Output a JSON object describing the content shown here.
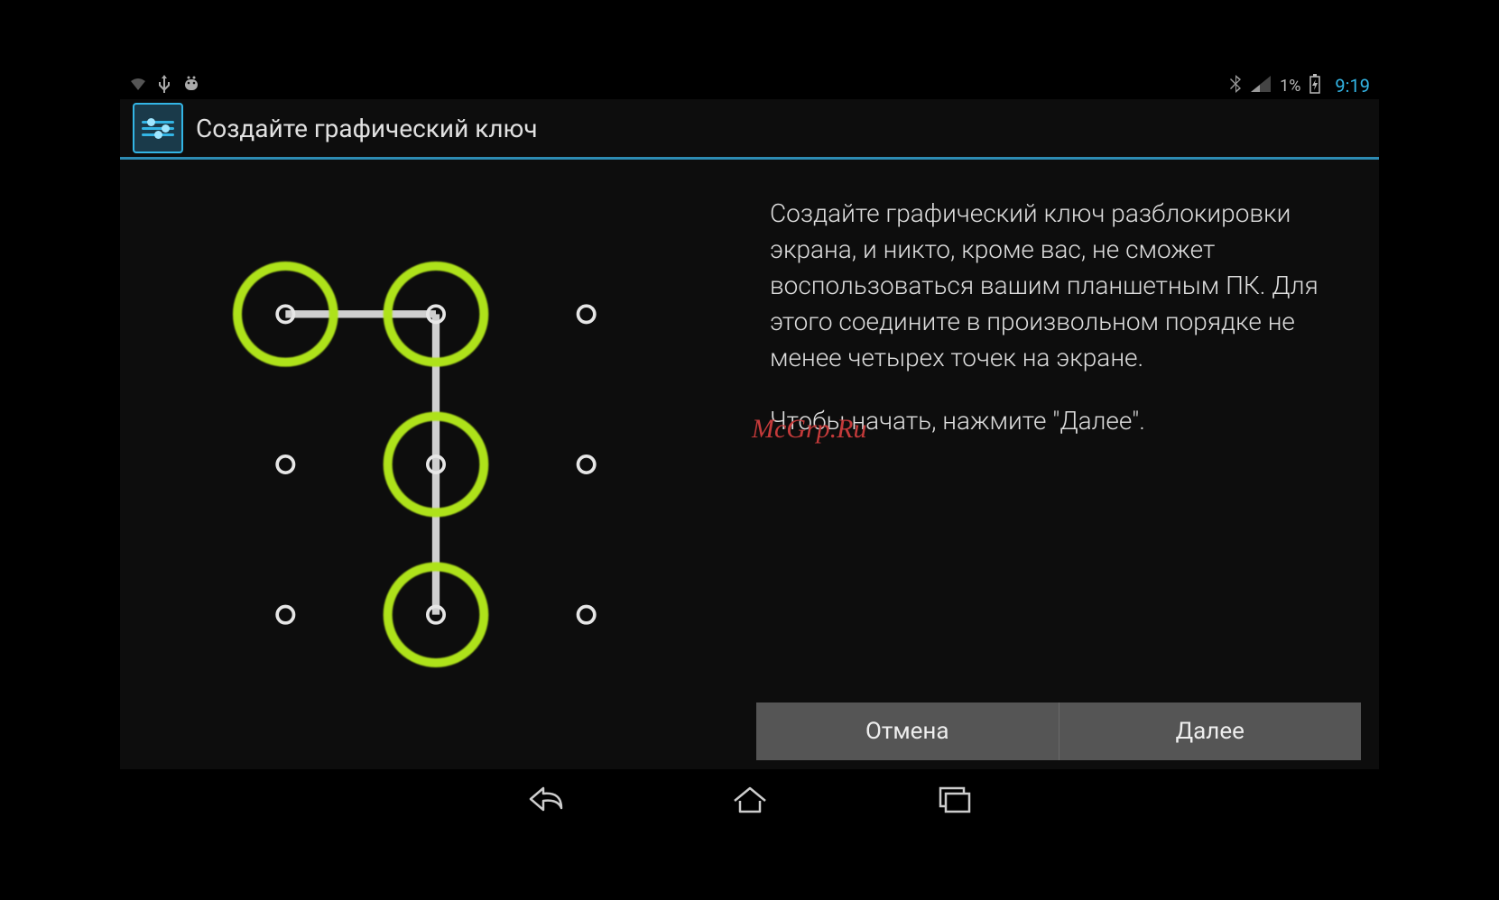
{
  "status": {
    "battery_pct": "1%",
    "clock": "9:19"
  },
  "title": "Создайте графический ключ",
  "instructions": {
    "p1": "Создайте графический ключ разблокировки экрана, и никто, кроме вас, не сможет воспользоваться вашим планшетным ПК. Для этого соедините в произвольном порядке не менее четырех точек на экране.",
    "p2": "Чтобы начать, нажмите \"Далее\"."
  },
  "watermark": "McGrp.Ru",
  "buttons": {
    "cancel": "Отмена",
    "next": "Далее"
  },
  "pattern": {
    "dots": [
      [
        0,
        0
      ],
      [
        1,
        0
      ],
      [
        2,
        0
      ],
      [
        0,
        1
      ],
      [
        1,
        1
      ],
      [
        2,
        1
      ],
      [
        0,
        2
      ],
      [
        1,
        2
      ],
      [
        2,
        2
      ]
    ],
    "selected": [
      [
        0,
        0
      ],
      [
        1,
        0
      ],
      [
        1,
        1
      ],
      [
        1,
        2
      ]
    ],
    "path": [
      [
        0,
        0
      ],
      [
        1,
        0
      ],
      [
        1,
        1
      ],
      [
        1,
        2
      ]
    ]
  }
}
